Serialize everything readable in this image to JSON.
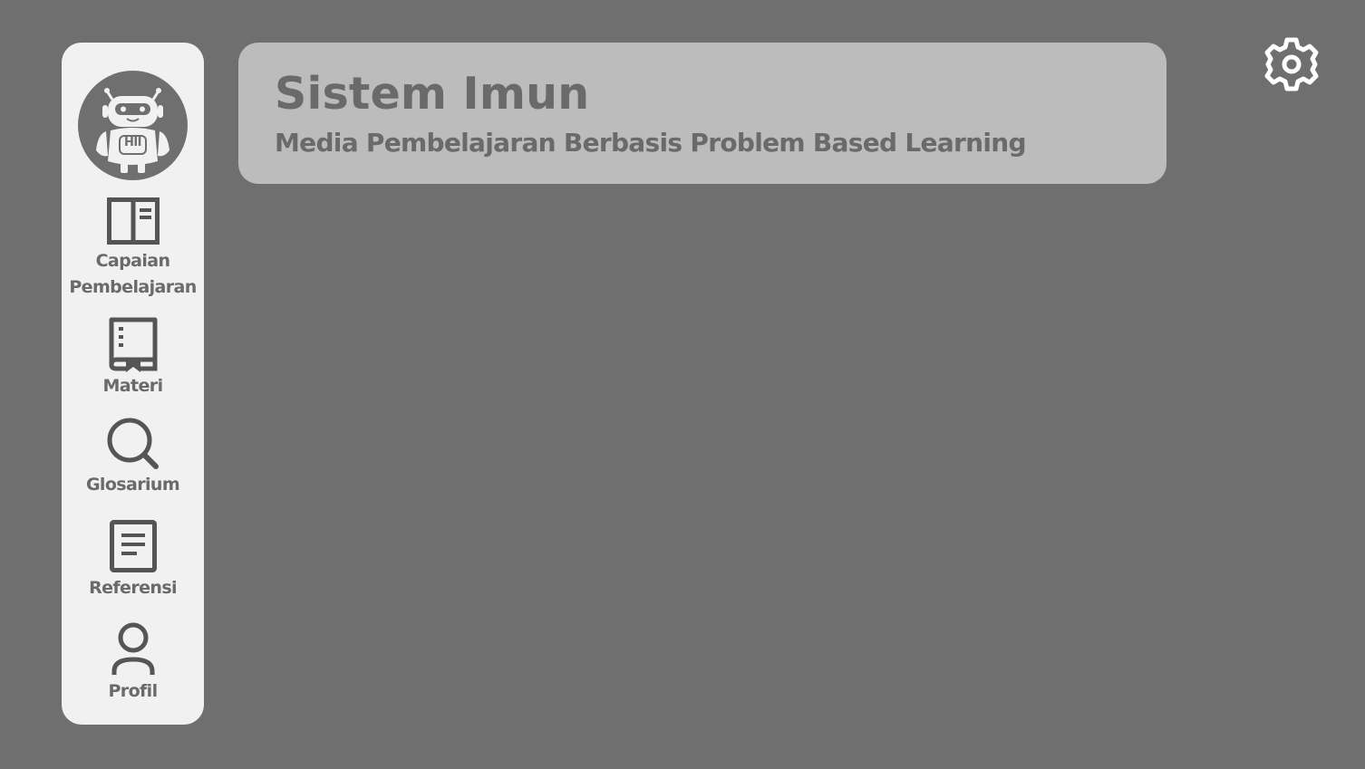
{
  "header": {
    "title": "Sistem Imun",
    "subtitle": "Media Pembelajaran Berbasis Problem Based Learning"
  },
  "sidebar": {
    "avatar_icon": "robot-icon",
    "avatar_badge": "HII",
    "items": [
      {
        "label": "Capaian\nPembelajaran",
        "icon": "book-open-icon"
      },
      {
        "label": "Materi",
        "icon": "book-icon"
      },
      {
        "label": "Glosarium",
        "icon": "search-icon"
      },
      {
        "label": "Referensi",
        "icon": "document-icon"
      },
      {
        "label": "Profil",
        "icon": "user-icon"
      }
    ]
  },
  "settings": {
    "icon": "gear-icon"
  },
  "colors": {
    "background": "#6f6f6f",
    "sidebar": "#f1f1f1",
    "header_card": "#bcbcbc",
    "text": "#6a6a6a",
    "icon": "#555555"
  }
}
